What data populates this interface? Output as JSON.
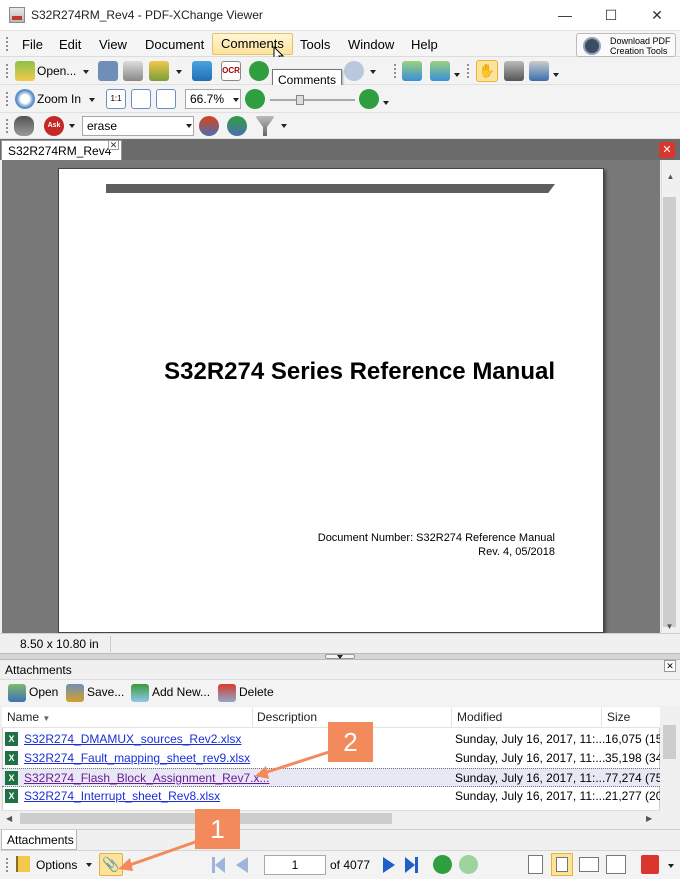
{
  "window": {
    "title": "S32R274RM_Rev4 - PDF-XChange Viewer",
    "minimize": "—",
    "maximize": "☐",
    "close": "✕"
  },
  "menu": {
    "items": [
      "File",
      "Edit",
      "View",
      "Document",
      "Comments",
      "Tools",
      "Window",
      "Help"
    ],
    "active": "Comments",
    "download_line1": "Download PDF",
    "download_line2": "Creation Tools"
  },
  "toolbar1": {
    "open_label": "Open...",
    "ocr_label": "OCR"
  },
  "tooltip": "Comments",
  "toolbar2": {
    "zoom_label": "Zoom In",
    "zoom_value": "66.7%"
  },
  "toolbar3": {
    "search_value": "erase"
  },
  "doc_tab": {
    "label": "S32R274RM_Rev4",
    "close": "✕"
  },
  "document": {
    "title": "S32R274 Series Reference Manual",
    "doc_number": "Document Number: S32R274 Reference Manual",
    "revision": "Rev. 4, 05/2018"
  },
  "status": {
    "page_size": "8.50 x 10.80 in"
  },
  "attachments": {
    "pane_title": "Attachments",
    "toolbar": {
      "open": "Open",
      "save": "Save...",
      "add_new": "Add New...",
      "delete": "Delete"
    },
    "columns": [
      "Name",
      "Description",
      "Modified",
      "Size"
    ],
    "rows": [
      {
        "name": "S32R274_DMAMUX_sources_Rev2.xlsx",
        "modified": "Sunday, July 16, 2017, 11:...",
        "size": "16,075 (15."
      },
      {
        "name": "S32R274_Fault_mapping_sheet_rev9.xlsx",
        "modified": "Sunday, July 16, 2017, 11:...",
        "size": "35,198 (34."
      },
      {
        "name": "S32R274_Flash_Block_Assignment_Rev7.x...",
        "modified": "Sunday, July 16, 2017, 11:...",
        "size": "77,274 (75."
      },
      {
        "name": "S32R274_Interrupt_sheet_Rev8.xlsx",
        "modified": "Sunday, July 16, 2017, 11:...",
        "size": "21,277 (20."
      }
    ],
    "tab_label": "Attachments"
  },
  "bottom": {
    "options_label": "Options",
    "page_value": "1",
    "page_total": "of 4077"
  },
  "callouts": {
    "one": "1",
    "two": "2"
  },
  "colors": {
    "accent": "#f38a5b",
    "link": "#1a2fd8",
    "active_menu": "#fde39a"
  }
}
